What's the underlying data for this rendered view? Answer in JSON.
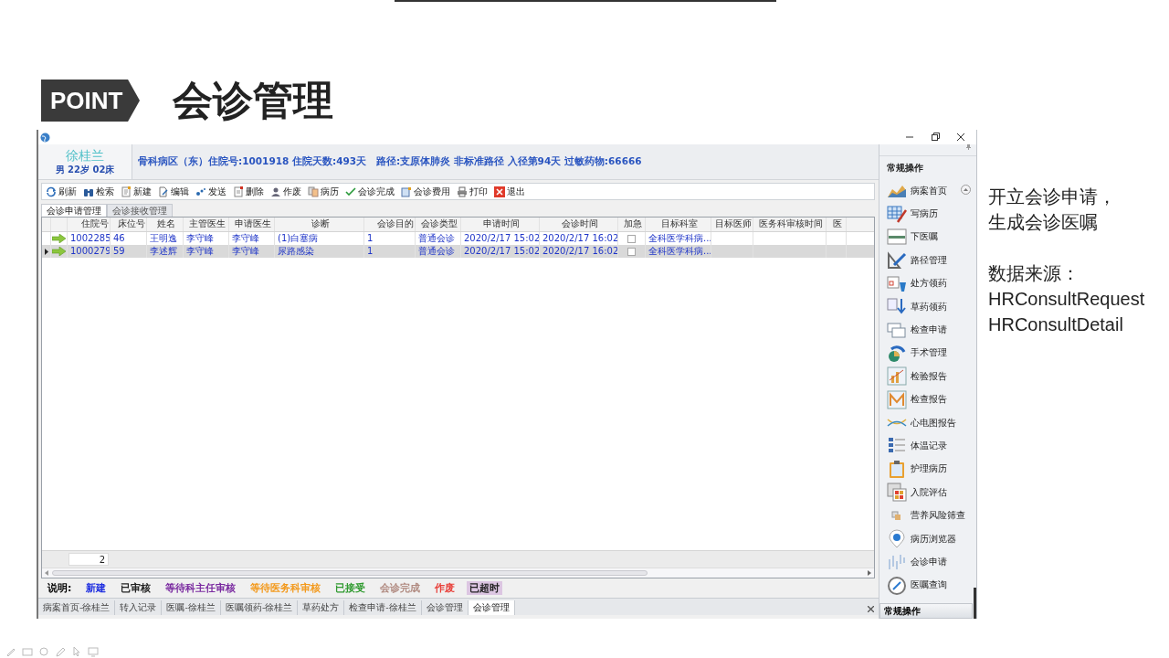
{
  "slide": {
    "badge": "POINT",
    "title": "会诊管理"
  },
  "window": {
    "patient": {
      "name": "徐桂兰",
      "details": "男 22岁 02床"
    },
    "banner": "骨科病区（东）住院号:1001918 住院天数:493天   路径:支原体肺炎 非标准路径 入径第94天 过敏药物:66666"
  },
  "toolbar": [
    {
      "label": "刷新"
    },
    {
      "label": "检索"
    },
    {
      "label": "新建"
    },
    {
      "label": "编辑"
    },
    {
      "label": "发送"
    },
    {
      "label": "删除"
    },
    {
      "label": "作废"
    },
    {
      "label": "病历"
    },
    {
      "label": "会诊完成"
    },
    {
      "label": "会诊费用"
    },
    {
      "label": "打印"
    },
    {
      "label": "退出"
    }
  ],
  "tabs": [
    {
      "label": "会诊申请管理",
      "selected": true
    },
    {
      "label": "会诊接收管理",
      "selected": false
    }
  ],
  "table": {
    "columns": [
      "住院号",
      "床位号",
      "姓名",
      "主管医生",
      "申请医生",
      "诊断",
      "会诊目的",
      "会诊类型",
      "申请时间",
      "会诊时间",
      "加急",
      "目标科室",
      "目标医师",
      "医务科审核时间",
      "医"
    ],
    "rows": [
      {
        "selected": false,
        "admission_no": "1002285",
        "bed": "46",
        "name": "王明逸",
        "attending": "李守峰",
        "requester": "李守峰",
        "diagnosis": "(1)白塞病",
        "purpose": "1",
        "type": "普通会诊",
        "request_time": "2020/2/17 15:02",
        "consult_time": "2020/2/17 16:02",
        "urgent": false,
        "target_dept": "全科医学科病..."
      },
      {
        "selected": true,
        "admission_no": "1000279",
        "bed": "59",
        "name": "李述辉",
        "attending": "李守峰",
        "requester": "李守峰",
        "diagnosis": "尿路感染",
        "purpose": "1",
        "type": "普通会诊",
        "request_time": "2020/2/17 15:02",
        "consult_time": "2020/2/17 16:02",
        "urgent": false,
        "target_dept": "全科医学科病..."
      }
    ],
    "row_count": "2"
  },
  "legend": {
    "label": "说明:",
    "items": [
      {
        "label": "新建",
        "color": "#1f2fe0"
      },
      {
        "label": "已审核",
        "color": "#222222"
      },
      {
        "label": "等待科主任审核",
        "color": "#7a2aa0"
      },
      {
        "label": "等待医务科审核",
        "color": "#f39a1e"
      },
      {
        "label": "已接受",
        "color": "#2f9a2f"
      },
      {
        "label": "会诊完成",
        "color": "#b08a80"
      },
      {
        "label": "作废",
        "color": "#e8403a"
      },
      {
        "label": "已超时",
        "color": "#222222",
        "kind": "highlighted"
      }
    ]
  },
  "bottom_tabs": [
    {
      "label": "病案首页-徐桂兰",
      "selected": false
    },
    {
      "label": "转入记录",
      "selected": false
    },
    {
      "label": "医嘱-徐桂兰",
      "selected": false
    },
    {
      "label": "医嘱领药-徐桂兰",
      "selected": false
    },
    {
      "label": "草药处方",
      "selected": false
    },
    {
      "label": "检查申请-徐桂兰",
      "selected": false
    },
    {
      "label": "会诊管理",
      "selected": false
    },
    {
      "label": "会诊管理",
      "selected": true
    }
  ],
  "sidebar": {
    "title": "常规操作",
    "items": [
      {
        "label": "病案首页"
      },
      {
        "label": "写病历"
      },
      {
        "label": "下医嘱"
      },
      {
        "label": "路径管理"
      },
      {
        "label": "处方领药"
      },
      {
        "label": "草药领药"
      },
      {
        "label": "检查申请"
      },
      {
        "label": "手术管理"
      },
      {
        "label": "检验报告"
      },
      {
        "label": "检查报告"
      },
      {
        "label": "心电图报告"
      },
      {
        "label": "体温记录"
      },
      {
        "label": "护理病历"
      },
      {
        "label": "入院评估"
      },
      {
        "label": "营养风险筛查"
      },
      {
        "label": "病历浏览器"
      },
      {
        "label": "会诊申请"
      },
      {
        "label": "医嘱查询"
      }
    ],
    "footer": "常规操作"
  },
  "notes": {
    "lines": [
      "开立会诊申请，",
      "生成会诊医嘱"
    ],
    "source_label": "数据来源：",
    "sources": [
      "HRConsultRequest",
      "HRConsultDetail"
    ]
  }
}
